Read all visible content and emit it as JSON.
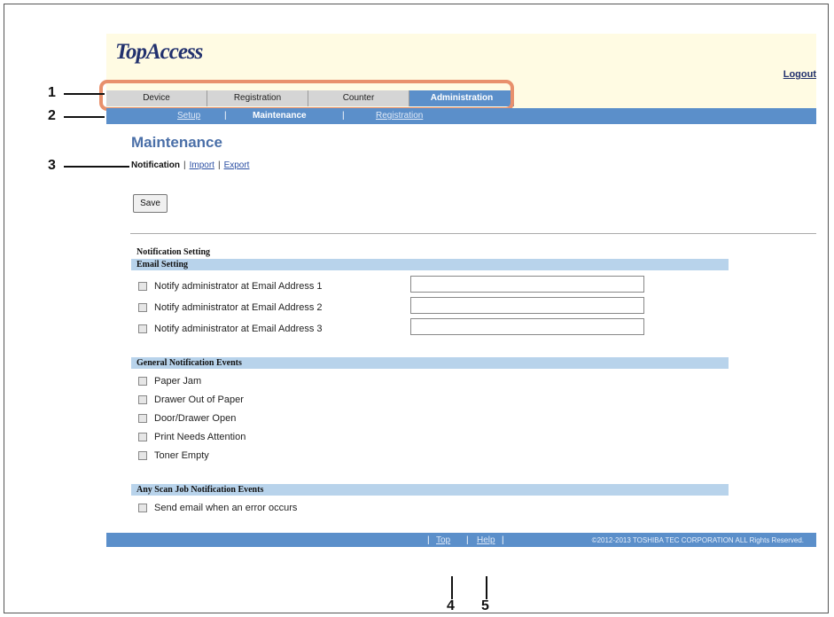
{
  "header": {
    "logo": "TopAccess",
    "logout_label": "Logout"
  },
  "tabs": [
    {
      "label": "Device",
      "active": false
    },
    {
      "label": "Registration",
      "active": false
    },
    {
      "label": "Counter",
      "active": false
    },
    {
      "label": "Administration",
      "active": true
    }
  ],
  "subnav": {
    "items": [
      {
        "label": "Setup",
        "active": false
      },
      {
        "label": "Maintenance",
        "active": true
      },
      {
        "label": "Registration",
        "active": false
      }
    ],
    "separator": "|"
  },
  "page": {
    "title": "Maintenance",
    "breadcrumb": {
      "current": "Notification",
      "links": [
        "Import",
        "Export"
      ],
      "separator": "|"
    },
    "save_label": "Save"
  },
  "notification_setting": {
    "title": "Notification Setting",
    "email_setting": {
      "header": "Email Setting",
      "rows": [
        {
          "label": "Notify administrator at Email Address 1",
          "checked": false,
          "value": ""
        },
        {
          "label": "Notify administrator at Email Address 2",
          "checked": false,
          "value": ""
        },
        {
          "label": "Notify administrator at Email Address 3",
          "checked": false,
          "value": ""
        }
      ]
    },
    "general_events": {
      "header": "General Notification Events",
      "items": [
        {
          "label": "Paper Jam",
          "checked": false
        },
        {
          "label": "Drawer Out of Paper",
          "checked": false
        },
        {
          "label": "Door/Drawer Open",
          "checked": false
        },
        {
          "label": "Print Needs Attention",
          "checked": false
        },
        {
          "label": "Toner Empty",
          "checked": false
        }
      ]
    },
    "scan_events": {
      "header": "Any Scan Job Notification Events",
      "items": [
        {
          "label": "Send email when an error occurs",
          "checked": false
        }
      ]
    }
  },
  "footer": {
    "top_label": "Top",
    "help_label": "Help",
    "separator": "|",
    "copyright": "©2012-2013 TOSHIBA TEC CORPORATION ALL Rights Reserved."
  },
  "callouts": [
    "1",
    "2",
    "3",
    "4",
    "5"
  ],
  "colors": {
    "header_bg": "#fffbe3",
    "nav_blue": "#5b8fca",
    "section_blue": "#b8d3eb",
    "title_blue": "#4a6fa8",
    "highlight_orange": "#e8906c"
  }
}
